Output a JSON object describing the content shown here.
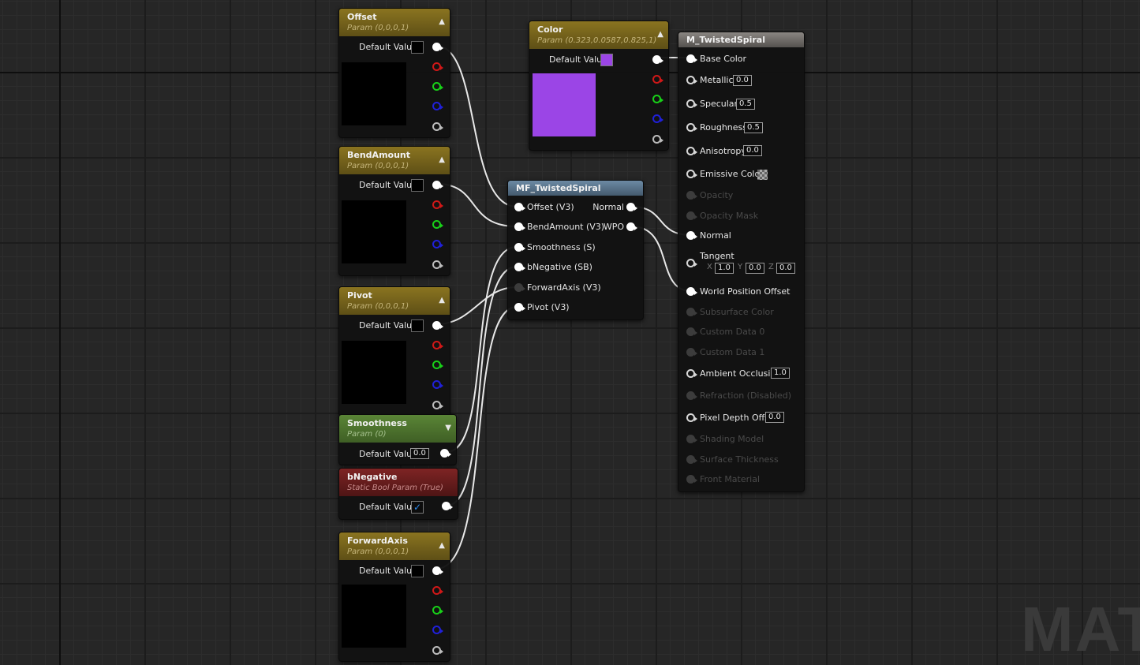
{
  "offset": {
    "title": "Offset",
    "subtitle": "Param (0,0,0,1)",
    "default_label": "Default Value"
  },
  "bend": {
    "title": "BendAmount",
    "subtitle": "Param (0,0,0,1)",
    "default_label": "Default Value"
  },
  "pivot": {
    "title": "Pivot",
    "subtitle": "Param (0,0,0,1)",
    "default_label": "Default Value"
  },
  "smooth": {
    "title": "Smoothness",
    "subtitle": "Param (0)",
    "default_label": "Default Value",
    "value": "0.0"
  },
  "bneg": {
    "title": "bNegative",
    "subtitle": "Static Bool Param (True)",
    "default_label": "Default Value",
    "check": "✓"
  },
  "fwd": {
    "title": "ForwardAxis",
    "subtitle": "Param (0,0,0,1)",
    "default_label": "Default Value"
  },
  "color": {
    "title": "Color",
    "subtitle": "Param (0.323,0.0587,0.825,1)",
    "default_label": "Default Value",
    "swatch": "#9b45e6"
  },
  "mf": {
    "title": "MF_TwistedSpiral",
    "inputs": [
      "Offset (V3)",
      "BendAmount (V3)",
      "Smoothness (S)",
      "bNegative (SB)",
      "ForwardAxis (V3)",
      "Pivot (V3)"
    ],
    "outputs": [
      "Normal",
      "WPO"
    ]
  },
  "mat": {
    "title": "M_TwistedSpiral",
    "base_color": "Base Color",
    "metallic": "Metallic",
    "metallic_val": "0.0",
    "specular": "Specular",
    "specular_val": "0.5",
    "roughness": "Roughness",
    "roughness_val": "0.5",
    "anisotropy": "Anisotropy",
    "anisotropy_val": "0.0",
    "emissive": "Emissive Color",
    "opacity": "Opacity",
    "opacity_mask": "Opacity Mask",
    "normal": "Normal",
    "tangent": "Tangent",
    "tx_label": "X",
    "tx": "1.0",
    "ty_label": "Y",
    "ty": "0.0",
    "tz_label": "Z",
    "tz": "0.0",
    "wpo": "World Position Offset",
    "subsurface": "Subsurface Color",
    "custom0": "Custom Data 0",
    "custom1": "Custom Data 1",
    "ao": "Ambient Occlusion",
    "ao_val": "1.0",
    "refraction": "Refraction (Disabled)",
    "pdo": "Pixel Depth Offset",
    "pdo_val": "0.0",
    "shading": "Shading Model",
    "thickness": "Surface Thickness",
    "front": "Front Material"
  },
  "watermark": "MATI"
}
